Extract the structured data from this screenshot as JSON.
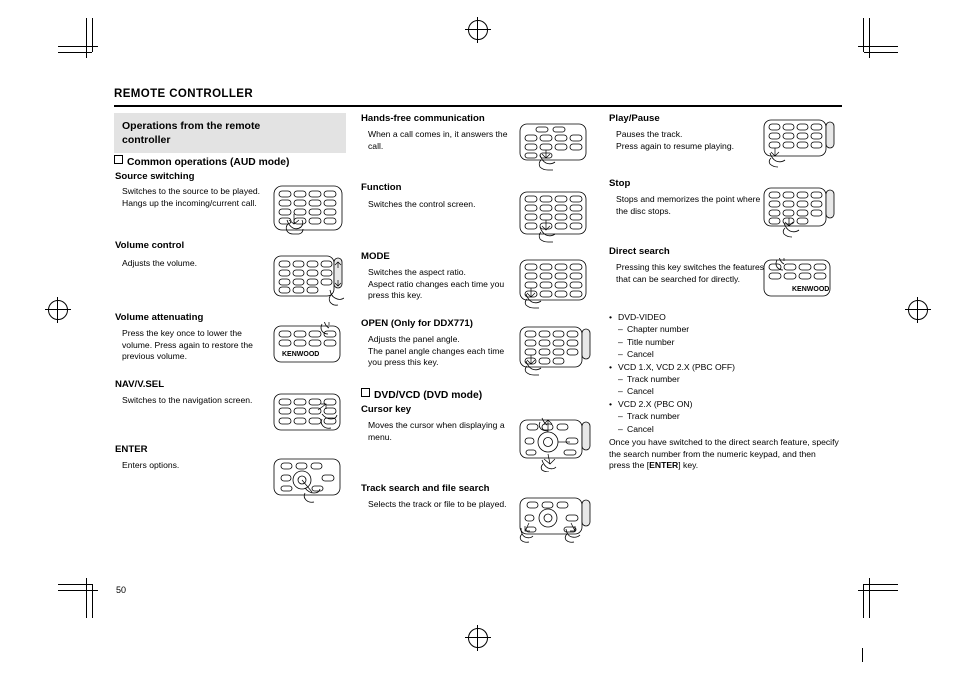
{
  "header": {
    "title": "REMOTE CONTROLLER"
  },
  "headingbox": {
    "line1": "Operations from the remote",
    "line2": "controller"
  },
  "page": {
    "number": "50"
  },
  "col1": {
    "section_common": "Common operations (AUD mode)",
    "items": [
      {
        "title": "Source switching",
        "body": "Switches to the source to be played.\nHangs up the incoming/current call."
      },
      {
        "title": "Volume control",
        "body": "Adjusts the volume."
      },
      {
        "title": "Volume attenuating",
        "body": "Press the key once to lower the volume. Press again to restore the previous volume."
      },
      {
        "title": "NAV/V.SEL",
        "body": "Switches to the navigation screen."
      },
      {
        "title": "ENTER",
        "body": "Enters options."
      }
    ]
  },
  "col2": {
    "items": [
      {
        "title": "Hands-free communication",
        "body": "When a call comes in, it answers the call."
      },
      {
        "title": "Function",
        "body": "Switches the control screen."
      },
      {
        "title": "MODE",
        "body": "Switches the aspect ratio.\nAspect ratio changes each time you press this key."
      },
      {
        "title": "OPEN (Only for DDX771)",
        "body": "Adjusts the panel angle.\nThe panel angle changes each time you press this key."
      }
    ],
    "section_dvd": "DVD/VCD (DVD mode)",
    "items2": [
      {
        "title": "Cursor key",
        "body": "Moves the cursor when displaying a menu."
      },
      {
        "title": "Track search and file search",
        "body": "Selects the track or file to be played."
      }
    ]
  },
  "col3": {
    "items": [
      {
        "title": "Play/Pause",
        "body": "Pauses the track.\nPress again to resume playing."
      },
      {
        "title": "Stop",
        "body": "Stops and memorizes the point where the disc stops."
      },
      {
        "title": "Direct search",
        "body": "Pressing this key switches the features that can be searched for directly."
      }
    ],
    "list": [
      {
        "type": "bullet",
        "text": "DVD-VIDEO"
      },
      {
        "type": "dash",
        "text": "Chapter number"
      },
      {
        "type": "dash",
        "text": "Title number"
      },
      {
        "type": "dash",
        "text": "Cancel"
      },
      {
        "type": "bullet",
        "text": "VCD 1.X, VCD 2.X (PBC OFF)"
      },
      {
        "type": "dash",
        "text": "Track number"
      },
      {
        "type": "dash",
        "text": "Cancel"
      },
      {
        "type": "bullet",
        "text": "VCD 2.X (PBC ON)"
      },
      {
        "type": "dash",
        "text": "Track number"
      },
      {
        "type": "dash",
        "text": "Cancel"
      }
    ],
    "note_pre": "Once you have switched to the direct search feature, specify the search number from the numeric keypad, and then press the [",
    "note_key": "ENTER",
    "note_post": "] key."
  },
  "brand": {
    "name": "KENWOOD"
  }
}
